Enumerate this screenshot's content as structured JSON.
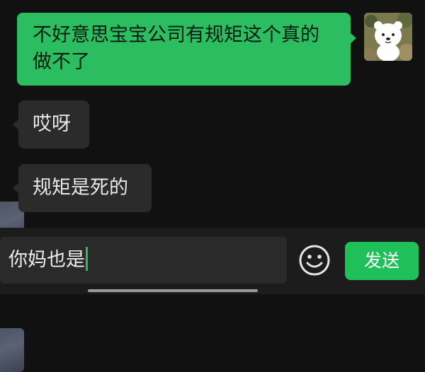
{
  "messages": [
    {
      "side": "out",
      "text": "不好意思宝宝公司有规矩这个真的做不了"
    },
    {
      "side": "in",
      "text": "哎呀"
    },
    {
      "side": "in",
      "text": "规矩是死的"
    }
  ],
  "composer": {
    "input_value": "你妈也是",
    "send_label": "发送",
    "emoji_icon": "smiley-face-icon"
  },
  "colors": {
    "outgoing_bubble": "#2bbd5f",
    "incoming_bubble": "#2b2b2b",
    "send_button": "#1fbf5a",
    "background": "#111111"
  }
}
